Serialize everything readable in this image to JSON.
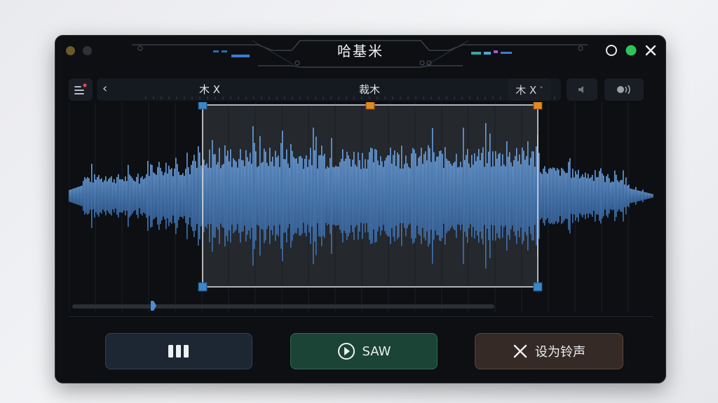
{
  "window": {
    "title": "哈基米",
    "colors": {
      "accent_wave": "#4f87c9",
      "save": "#1b4437",
      "ring": "#352a26",
      "pause": "#1d2633"
    }
  },
  "toolbar": {
    "left_label": "木 X",
    "center_label": "裁木",
    "right_label": "木 X",
    "right_chevron": "˅",
    "back_icon": "‹"
  },
  "playback": {
    "scrub_position": 0.19,
    "selection_start": 0.23,
    "selection_end": 0.8
  },
  "buttons": {
    "pause_icon": "pause-icon",
    "save_label": "SAW",
    "ringtone_label": "设为铃声"
  }
}
